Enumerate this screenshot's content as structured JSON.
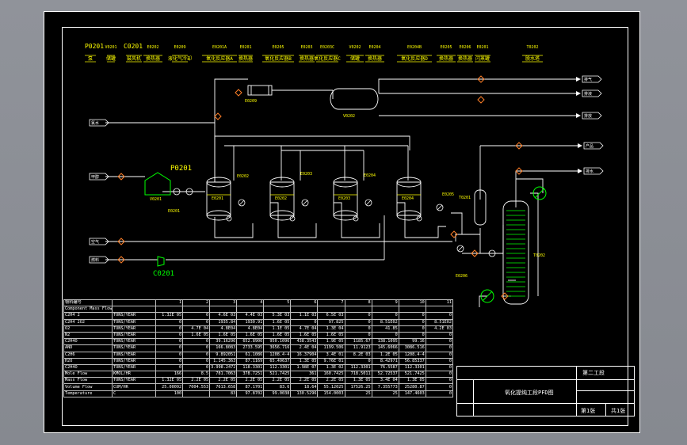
{
  "header": {
    "codes": [
      "P0201",
      "V0201",
      "C0201",
      "E0202",
      "E0209",
      "E0201A",
      "E0201",
      "E0205",
      "E0203",
      "E0203C",
      "V0202",
      "E0204",
      "E0204B",
      "E0205",
      "E0206",
      "E0201",
      "T0202"
    ],
    "names": [
      "泵",
      "储罐",
      "鼓风机",
      "换热器",
      "液化气冷却",
      "氧化反应器A",
      "换热器",
      "氧化反应器B",
      "换热器",
      "氧化反应器C",
      "储罐",
      "换热器",
      "氧化反应器D",
      "换热器",
      "换热器",
      "闪蒸罐",
      "脱水塔"
    ]
  },
  "equipment_labels": {
    "E0201": "E0201",
    "E0202": "E0202",
    "E0203": "E0203",
    "E0204": "E0204",
    "E0205": "E0205",
    "E0206": "E0206",
    "E0209": "E0209",
    "V0201": "V0201",
    "V0202": "V0202",
    "P0201": "P0201",
    "C0201": "C0201",
    "T0201": "T0201",
    "T0202": "T0202",
    "EB0201": "E0201",
    "R0201": "E0201",
    "R0202": "E0202",
    "R0203": "E0203",
    "R0204": "E0204"
  },
  "streams": {
    "left": [
      "氯水",
      "甲醇",
      "空气",
      "燃料"
    ],
    "right": [
      "排气",
      "排液",
      "排放",
      "产品",
      "排水"
    ]
  },
  "table": {
    "header_row": [
      "物料编号",
      "",
      "1",
      "2",
      "3",
      "4",
      "5",
      "6",
      "7",
      "8",
      "9",
      "10",
      "11"
    ],
    "rows": [
      [
        "Component Mass Flow（质量流量）",
        "",
        "",
        "",
        "",
        "",
        "",
        "",
        "",
        "",
        "",
        "",
        ""
      ],
      [
        "C2H4 2",
        "TONS/YEAR",
        "1.32E 05",
        "0",
        "4.6E 03",
        "4.4E 03",
        "5.3E 03",
        "1.1E 03",
        "6.5E 03",
        "0",
        "0",
        "0",
        "0"
      ],
      [
        "C2H4 2O2",
        "TONS/YEAR",
        "0",
        "0",
        "1935.84",
        "1930.91",
        "1.6E 05",
        "0",
        "97.825",
        "0",
        "8.51E02",
        "0",
        "8.51E02"
      ],
      [
        "O2",
        "TONS/YEAR",
        "0",
        "4.7E 04",
        "4.8E04",
        "4.8E04",
        "1.1E 05",
        "4.7E 04",
        "1.3E 04",
        "0",
        "41.85",
        "0",
        "4.2E 03"
      ],
      [
        "N2",
        "TONS/YEAR",
        "0",
        "1.6E 05",
        "1.6E 05",
        "1.6E 05",
        "1.6E 05",
        "1.6E 05",
        "1.6E 05",
        "0",
        "0",
        "0",
        "0"
      ],
      [
        "C2H4O",
        "TONS/YEAR",
        "0",
        "0",
        "39.16296",
        "652.8906",
        "950.1096",
        "438.3543",
        "1.9E 05",
        "1185.67",
        "138.1095",
        "99.16",
        "0"
      ],
      [
        "AND",
        "TONS/YEAR",
        "0",
        "0",
        "166.8083",
        "2733.595",
        "3656.716",
        "2.4E 04",
        "1199.506",
        "11.9123",
        "145.6066",
        "3086.516",
        "0"
      ],
      [
        "C2H6",
        "TONS/YEAR",
        "0",
        "0",
        "9.892051",
        "61.1086",
        "1208.4-4",
        "16.37904",
        "3.4E 01",
        "8.2E 03",
        "1.2E 05",
        "1208.4-4",
        "0"
      ],
      [
        "H2O",
        "TONS/YEAR",
        "0",
        "0",
        "1.145.363",
        "87.1169",
        "65.49637",
        "1.3E 05",
        "9.76E 01",
        "0",
        "8.42971",
        "56.85337",
        "0"
      ],
      [
        "C2H4O",
        "TONS/YEAR",
        "0",
        "0",
        "3.998.2472",
        "118.3301",
        "112.3301",
        "1.98E 07",
        "1.3E 02",
        "112.3301",
        "76.5587",
        "112.3301",
        "0"
      ],
      [
        "Mole Flow",
        "KMOL/HR",
        "166",
        "8.5",
        "781.7063",
        "378.7251",
        "521.7425",
        "361",
        "160.7425",
        "718.5011",
        "52.72537",
        "521.7425",
        "0"
      ],
      [
        "Mass Flow",
        "TONS/YEAR",
        "1.32E 05",
        "2.2E 05",
        "2.2E 05",
        "2.2E 05",
        "2.2E 05",
        "2.2E 05",
        "2.2E 05",
        "1.3E 05",
        "3.4E 04",
        "1.3E 05",
        "0"
      ],
      [
        "Volume Flow",
        "CUM/HR",
        "25.00092",
        "7004.553",
        "7613.658",
        "87.1701",
        "83.6",
        "18.64",
        "55.12025",
        "17526.25",
        "7.355773",
        "25280.87",
        "0"
      ],
      [
        "Temperature",
        "C",
        "100",
        "",
        "83",
        "97.8702",
        "99.0038",
        "130.5296",
        "154.0003",
        "25",
        "25",
        "147.4603",
        "0"
      ]
    ]
  },
  "titleblock": {
    "company": "第二工段",
    "title": "氧化提纯工段PFD图",
    "sheet": "第1张",
    "sheets": "共1张"
  },
  "colors": {
    "background": "#000000",
    "lines": "#ffffff",
    "labels": "#ffff00",
    "valves": "#ff7f27",
    "new_equipment": "#00ff00"
  }
}
